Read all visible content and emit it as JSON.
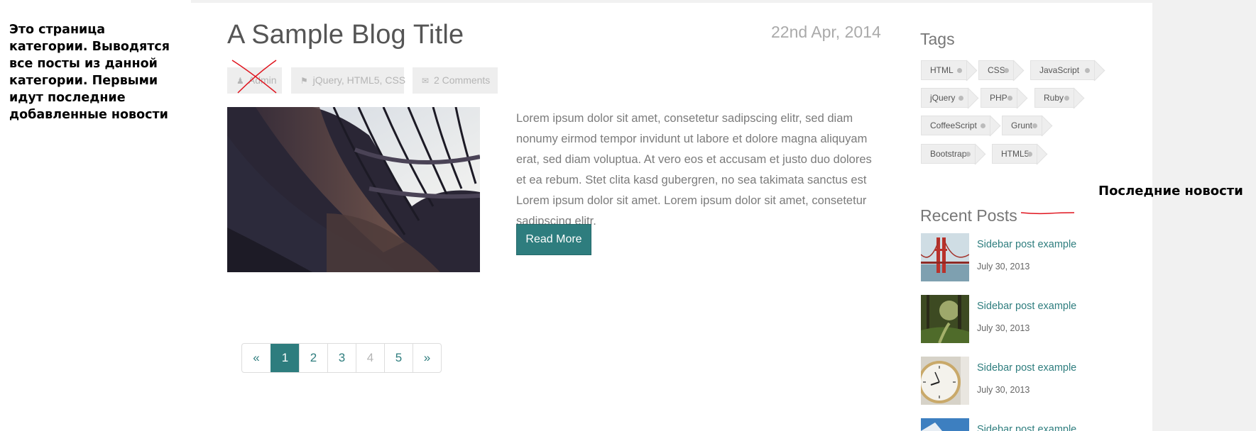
{
  "annotations": {
    "left_note": "Это страница категории. Выводятся все посты из данной категории. Первыми идут последние добавленные новости",
    "right_note": "Последние новости"
  },
  "post": {
    "title": "A Sample Blog Title",
    "date": "22nd Apr, 2014",
    "author": "Admin",
    "tags": [
      "jQuery",
      "HTML5",
      "CSS"
    ],
    "comments": "2 Comments",
    "body": "Lorem ipsum dolor sit amet, consetetur sadipscing elitr, sed diam nonumy eirmod tempor invidunt ut labore et dolore magna aliquyam erat, sed diam voluptua. At vero eos et accusam et justo duo dolores et ea rebum. Stet clita kasd gubergren, no sea takimata sanctus est Lorem ipsum dolor sit amet. Lorem ipsum dolor sit amet, consetetur sadipscing elitr.",
    "read_more": "Read More"
  },
  "pagination": {
    "prev": "«",
    "pages": [
      "1",
      "2",
      "3",
      "4",
      "5"
    ],
    "active": "1",
    "next": "»"
  },
  "sidebar": {
    "tags_heading": "Tags",
    "tags": [
      "HTML",
      "CSS",
      "JavaScript",
      "jQuery",
      "PHP",
      "Ruby",
      "CoffeeScript",
      "Grunt",
      "Bootstrap",
      "HTML5"
    ],
    "recent_heading": "Recent Posts",
    "recent_posts": [
      {
        "title": "Sidebar post example",
        "date": "July 30, 2013"
      },
      {
        "title": "Sidebar post example",
        "date": "July 30, 2013"
      },
      {
        "title": "Sidebar post example",
        "date": "July 30, 2013"
      },
      {
        "title": "Sidebar post example",
        "date": ""
      }
    ]
  },
  "colors": {
    "accent": "#2e7d7e",
    "meta_bg": "#eeeeee",
    "annotation_red": "#e0141e"
  },
  "icons": {
    "author": "user-icon",
    "tags": "tag-icon",
    "comments": "comments-icon"
  }
}
